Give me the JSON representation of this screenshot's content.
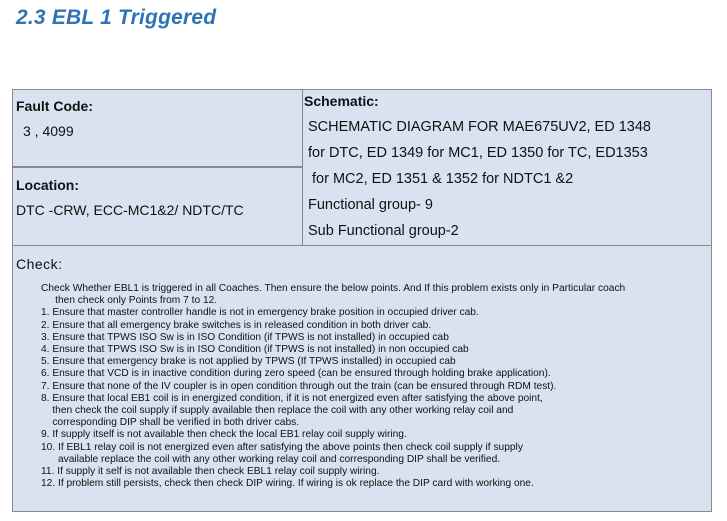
{
  "title": "2.3 EBL 1 Triggered",
  "fault": {
    "heading": "Fault Code:",
    "value": "3 , 4099"
  },
  "location": {
    "heading": "Location:",
    "value": "DTC -CRW, ECC-MC1&2/ NDTC/TC"
  },
  "schematic": {
    "heading": "Schematic:",
    "lines": [
      "SCHEMATIC DIAGRAM FOR MAE675UV2, ED 1348",
      "for DTC, ED 1349 for MC1, ED 1350 for TC, ED1353",
      " for MC2, ED 1351 & 1352 for NDTC1 &2",
      "Functional group- 9",
      "Sub Functional group-2"
    ]
  },
  "check": {
    "heading": "Check:",
    "lines": [
      "Check Whether EBL1 is triggered in all Coaches. Then ensure the below points. And If this problem exists only in Particular coach",
      "     then check only Points from 7 to 12.",
      "1. Ensure that master controller handle is not in emergency brake position in occupied driver cab.",
      "2. Ensure that all emergency brake switches is in released condition in both driver cab.",
      "3. Ensure that TPWS ISO Sw is in ISO Condition (if TPWS is not installed) in occupied cab",
      "4. Ensure that TPWS ISO Sw is in ISO Condition (if TPWS is not installed) in non occupied cab",
      "5. Ensure that emergency brake is not applied by TPWS (If TPWS installed) in occupied cab",
      "6. Ensure that VCD is in inactive condition during zero speed (can be ensured through holding brake application).",
      "7. Ensure that none of the IV coupler is in open condition through out the train (can be ensured through RDM test).",
      "8. Ensure that local EB1 coil is in energized condition, if it is not energized even after satisfying the above point,",
      "    then check the coil supply if supply available then replace the coil with any other working relay coil and",
      "    corresponding DIP shall be verified in both driver cabs.",
      "9. If supply itself is not available then check the local EB1 relay coil supply wiring.",
      "10. If EBL1 relay coil is not energized even after satisfying the above points then check coil supply if supply",
      "      available replace the coil with any other working relay coil and corresponding DIP shall be verified.",
      "11. If supply it self is not available then check EBL1 relay coil supply wiring.",
      "12. If problem still persists, check then check DIP wiring. If wiring is ok replace the DIP card with working one."
    ]
  }
}
